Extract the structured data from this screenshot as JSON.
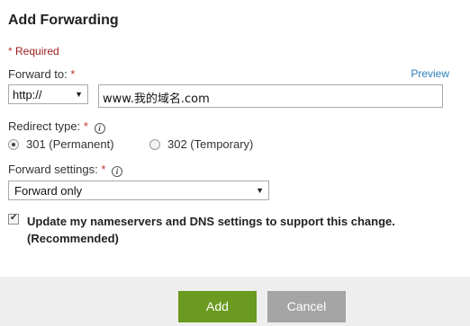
{
  "dialog": {
    "title": "Add Forwarding",
    "required_star": "*",
    "required_text": "Required"
  },
  "forward_to": {
    "label": "Forward to:",
    "star": "*",
    "preview_link": "Preview",
    "protocol_selected": "http://",
    "domain_value": "www.我的域名.com"
  },
  "redirect_type": {
    "label": "Redirect type:",
    "star": "*",
    "options": [
      {
        "label": "301 (Permanent)",
        "checked": true
      },
      {
        "label": "302 (Temporary)",
        "checked": false
      }
    ]
  },
  "forward_settings": {
    "label": "Forward settings:",
    "star": "*",
    "selected": "Forward only"
  },
  "update_dns": {
    "checked": true,
    "label": "Update my nameservers and DNS settings to support this change. (Recommended)"
  },
  "buttons": {
    "add": "Add",
    "cancel": "Cancel"
  },
  "colors": {
    "accent_green": "#6a9a1f",
    "cancel_gray": "#a5a5a5",
    "link_blue": "#2a7fb8",
    "required_red": "#9a1b1b"
  },
  "icons": {
    "info": "info-icon",
    "dropdown": "chevron-down-icon",
    "checkmark": "checkmark-icon"
  }
}
